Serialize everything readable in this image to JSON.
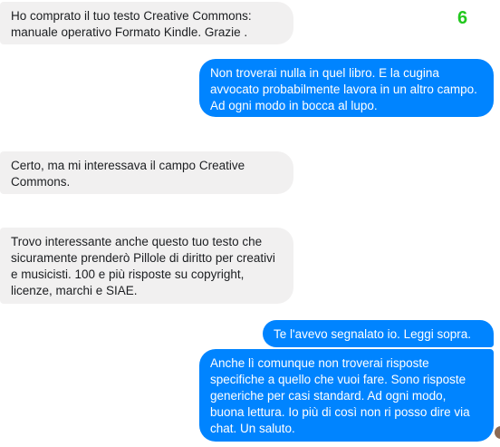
{
  "page_number": "6",
  "messages": [
    {
      "from": "other",
      "text": "Ho comprato il tuo testo Creative Commons: manuale operativo Formato Kindle. Grazie ."
    },
    {
      "from": "me",
      "text": "Non troverai nulla in quel libro. E la cugina avvocato probabilmente lavora in un altro campo. Ad ogni modo in bocca al lupo."
    },
    {
      "from": "other",
      "text": "Certo, ma mi interessava il campo Creative Commons."
    },
    {
      "from": "other",
      "text": "Trovo interessante anche questo tuo testo che sicuramente prenderò  Pillole di diritto per creativi e musicisti. 100 e più risposte su copyright, licenze, marchi e SIAE."
    },
    {
      "from": "me",
      "text": "Te l'avevo segnalato io. Leggi sopra."
    },
    {
      "from": "me",
      "text": "Anche lì comunque non troverai risposte specifiche a quello che vuoi fare. Sono risposte generiche per casi standard. Ad ogni modo, buona lettura. Io più di così non ri posso dire via chat. Un saluto."
    }
  ]
}
